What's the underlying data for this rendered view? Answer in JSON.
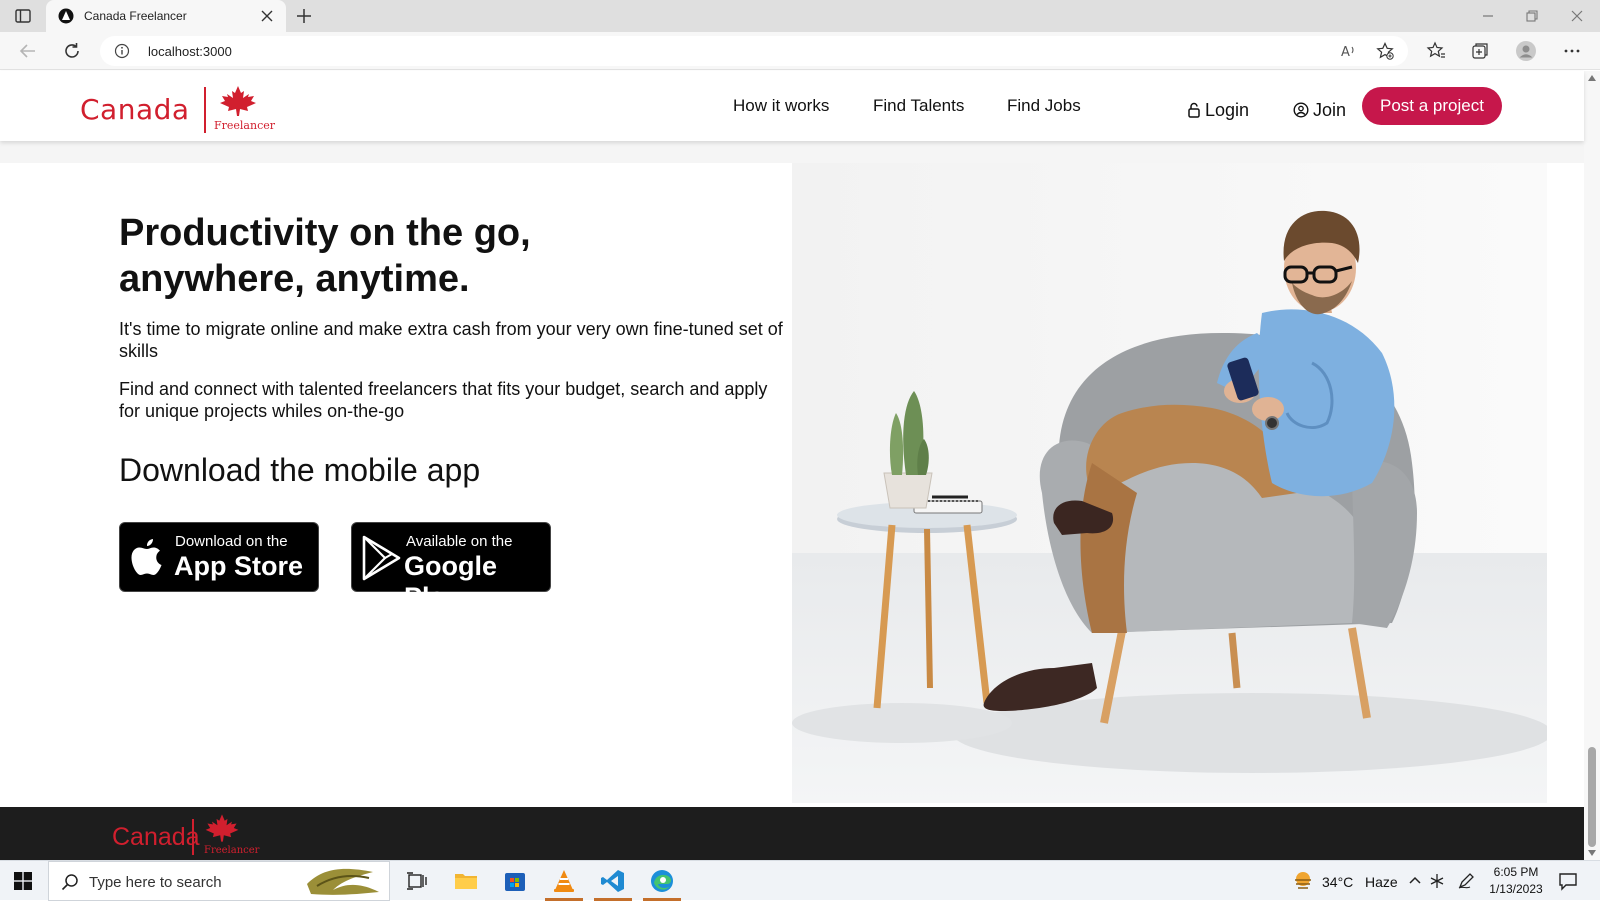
{
  "browser": {
    "tab_title": "Canada Freelancer",
    "url": "localhost:3000"
  },
  "header": {
    "logo_word": "Canada",
    "logo_sub": "Freelancer",
    "nav": [
      "How it works",
      "Find Talents",
      "Find Jobs"
    ],
    "login_label": "Login",
    "join_label": "Join",
    "post_project_label": "Post a project"
  },
  "hero": {
    "title_line1": "Productivity on the go,",
    "title_line2": "anywhere, anytime.",
    "paragraph1": "It's time to migrate online and make extra cash from your very own fine-tuned set of skills",
    "paragraph2": "Find and connect with talented freelancers that fits your budget, search and apply for unique projects whiles on-the-go",
    "download_title": "Download the mobile app",
    "app_store": {
      "small": "Download on the",
      "big": "App Store"
    },
    "google_play": {
      "small": "Available on the",
      "big": "Google Play"
    }
  },
  "footer": {
    "logo_word": "Canada",
    "logo_sub": "Freelancer"
  },
  "taskbar": {
    "search_placeholder": "Type here to search",
    "weather_temp": "34°C",
    "weather_desc": "Haze",
    "time": "6:05 PM",
    "date": "1/13/2023"
  },
  "colors": {
    "brand_red": "#d11f2e",
    "post_button": "#c6174b",
    "footer_bg": "#1d1d1d"
  }
}
